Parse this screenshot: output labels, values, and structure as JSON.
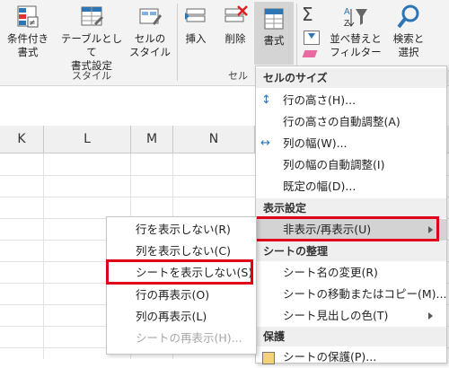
{
  "ribbon": {
    "conditional_format_label": "条件付き\n書式",
    "table_format_label": "テーブルとして\n書式設定",
    "cell_style_label": "セルの\nスタイル",
    "styles_group": "スタイル",
    "insert_label": "挿入",
    "delete_label": "削除",
    "format_label": "書式",
    "cells_group": "セル",
    "sort_filter_label": "並べ替えと\nフィルター",
    "find_select_label": "検索と\n選択",
    "sigma": "Σ"
  },
  "columns": [
    "K",
    "L",
    "M",
    "N"
  ],
  "format_menu": {
    "section_size": "セルのサイズ",
    "row_height": "行の高さ(H)...",
    "autofit_row": "行の高さの自動調整(A)",
    "col_width": "列の幅(W)...",
    "autofit_col": "列の幅の自動調整(I)",
    "default_width": "既定の幅(D)...",
    "section_visibility": "表示設定",
    "hide_unhide": "非表示/再表示(U)",
    "section_organize": "シートの整理",
    "rename_sheet": "シート名の変更(R)",
    "move_copy": "シートの移動またはコピー(M)...",
    "tab_color": "シート見出しの色(T)",
    "section_protect": "保護",
    "protect_sheet": "シートの保護(P)..."
  },
  "hide_menu": {
    "hide_rows": "行を表示しない(R)",
    "hide_cols": "列を表示しない(C)",
    "hide_sheet": "シートを表示しない(S)",
    "unhide_rows": "行の再表示(O)",
    "unhide_cols": "列の再表示(L)",
    "unhide_sheet": "シートの再表示(H)..."
  },
  "colors": {
    "highlight": "#e1001a",
    "ribbon_bg": "#f3f3f3"
  }
}
